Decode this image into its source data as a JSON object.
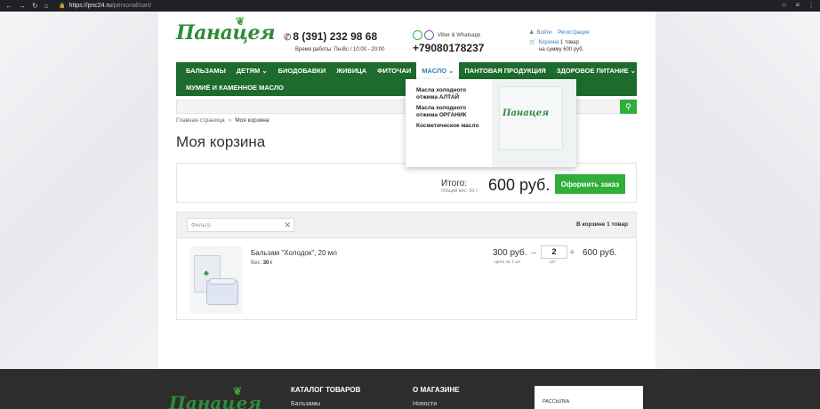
{
  "browser": {
    "url_host": "https://pnc24.ru",
    "url_path": "/personal/cart/"
  },
  "header": {
    "logo": "Панацея",
    "phone": "8 (391) 232 98 68",
    "hours": "Время работы: Пн-Вс / 10:00 - 20:00",
    "messenger_label": "Viber & Whatsapp",
    "mobile": "+79080178237",
    "login": "Войти",
    "register": "Регистрация",
    "cart_link": "Корзина",
    "cart_count": "1 товар",
    "cart_sum": "на сумму 600 руб."
  },
  "menu": {
    "row1": [
      "БАЛЬЗАМЫ",
      "ДЕТЯМ ⌄",
      "БИОДОБАВКИ",
      "ЖИВИЦА",
      "ФИТОЧАИ",
      "МАСЛО ⌄",
      "ПАНТОВАЯ ПРОДУКЦИЯ",
      "ЗДОРОВОЕ ПИТАНИЕ ⌄"
    ],
    "row2": [
      "МУМИЁ И КАМЕННОЕ МАСЛО"
    ],
    "active": "МАСЛО ⌄"
  },
  "dropdown": {
    "items": [
      "Масла холодного отжима АЛТАЙ",
      "Масла холодного отжима ОРГАНИК",
      "Косметическое масло"
    ],
    "image_logo": "Панацея"
  },
  "breadcrumb": {
    "home": "Главная страница",
    "separator": "»",
    "current": "Моя корзина"
  },
  "page_title": "Моя корзина",
  "summary": {
    "total_label": "Итого:",
    "weight": "Общий вес: 60 г",
    "total": "600 руб.",
    "order_button": "Оформить заказ"
  },
  "cart": {
    "filter_placeholder": "Фильтр",
    "in_cart": "В корзине 1 товар",
    "items": [
      {
        "name": "Бальзам \"Холодок\", 20 мл",
        "weight_label": "Вес",
        "weight": "30 г",
        "price": "300 руб.",
        "price_label": "цена за 1 шт",
        "qty": "2",
        "qty_label": "шт",
        "sum": "600 руб."
      }
    ]
  },
  "footer": {
    "logo": "Панацея",
    "catalog_title": "КАТАЛОГ ТОВАРОВ",
    "catalog_first": "Бальзамы",
    "about_title": "О МАГАЗИНЕ",
    "about_first": "Новости",
    "newsletter": "РАССЫЛКА"
  },
  "colors": {
    "brand_green": "#1d6b2d",
    "button_green": "#2fae3a",
    "link_blue": "#3a7cc0"
  }
}
